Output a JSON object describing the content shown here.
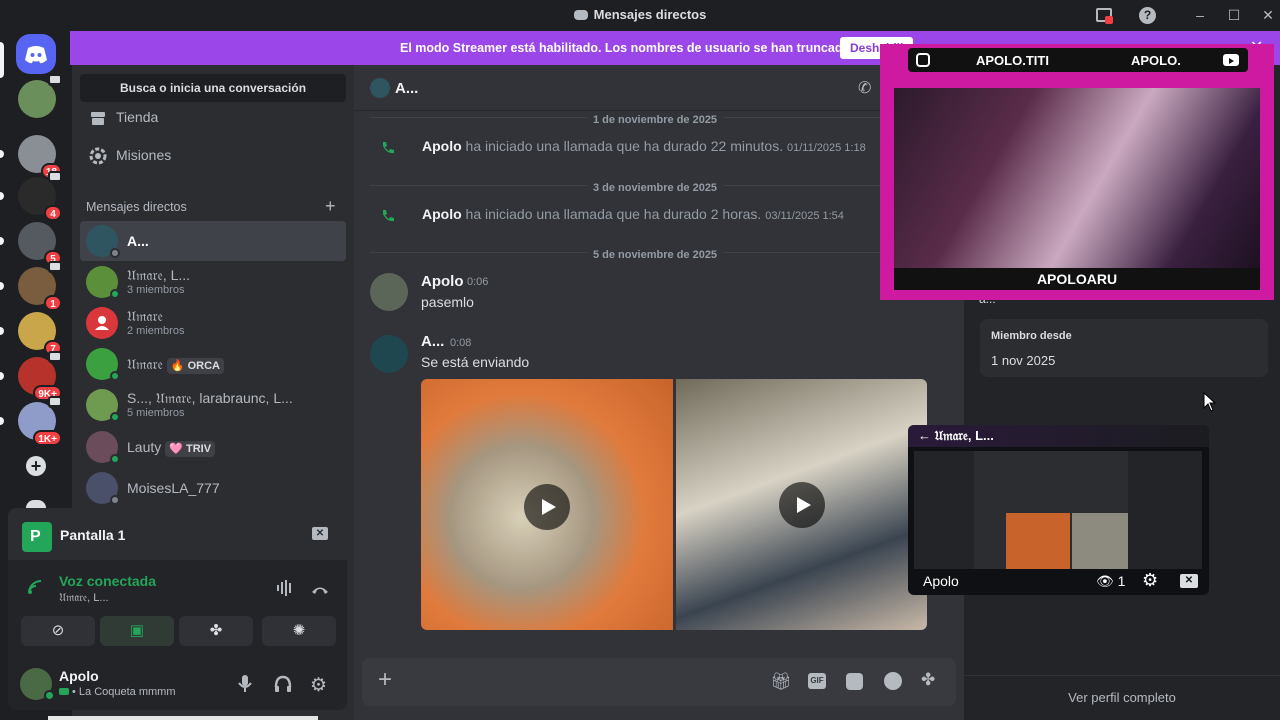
{
  "window": {
    "title": "Mensajes directos"
  },
  "banner": {
    "message": "El modo Streamer está habilitado. Los nombres de usuario se han truncado.",
    "button_label": "Deshabili"
  },
  "servers": {
    "badges": [
      "18",
      "4",
      "5",
      "1",
      "7",
      "9K+",
      "1K+"
    ]
  },
  "sidebar": {
    "search_label": "Busca o inicia una conversación",
    "nav": [
      {
        "label": "Tienda",
        "icon": "shop-icon"
      },
      {
        "label": "Misiones",
        "icon": "quests-icon"
      }
    ],
    "dm_header": "Mensajes directos",
    "dms": [
      {
        "name": "A...",
        "sub": "",
        "tag": ""
      },
      {
        "name": "𝔘𝔪𝔞𝔯𝔢, L...",
        "sub": "3 miembros",
        "tag": ""
      },
      {
        "name": "𝔘𝔪𝔞𝔯𝔢",
        "sub": "2 miembros",
        "tag": ""
      },
      {
        "name": "𝔘𝔪𝔞𝔯𝔢",
        "sub": "",
        "tag": "🔥 ORCA"
      },
      {
        "name": "S..., 𝔘𝔪𝔞𝔯𝔢, larabraunc, L...",
        "sub": "5 miembros",
        "tag": ""
      },
      {
        "name": "Lauty",
        "sub": "",
        "tag": "🩷 TRIV"
      },
      {
        "name": "MoisesLA_777",
        "sub": "",
        "tag": ""
      }
    ]
  },
  "voice": {
    "screen_label": "Pantalla 1",
    "status": "Voz conectada",
    "channel": "𝔘𝔪𝔞𝔯𝔢, L..."
  },
  "user": {
    "name": "Apolo",
    "status": "• La Coqueta mmmm"
  },
  "chat": {
    "header_name": "A...",
    "dividers": [
      "1 de noviembre de 2025",
      "3 de noviembre de 2025",
      "5 de noviembre de 2025"
    ],
    "calls": [
      {
        "who": "Apolo",
        "text": "ha iniciado una llamada que ha durado 22 minutos.",
        "time": "01/11/2025 1:18"
      },
      {
        "who": "Apolo",
        "text": "ha iniciado una llamada que ha durado 2 horas.",
        "time": "03/11/2025 1:54"
      }
    ],
    "messages": [
      {
        "author": "Apolo",
        "time": "0:06",
        "text": "pasemlo"
      },
      {
        "author": "A...",
        "time": "0:08",
        "text": "Se está enviando"
      }
    ]
  },
  "profile": {
    "truncated_name": "a...",
    "member_since_label": "Miembro desde",
    "member_since": "1 nov 2025",
    "view_full": "Ver perfil completo"
  },
  "overlay": {
    "social_left": "APOLO.TITI",
    "social_right": "APOLO.",
    "cam_name": "APOLOARU",
    "pip_title": "← 𝔘𝔪𝔞𝔯𝔢, L...",
    "pip_user": "Apolo",
    "pip_viewers": "1"
  },
  "colors": {
    "accent": "#5865f2",
    "banner": "#9b46e8",
    "online": "#23a55a",
    "overlay": "#cd1aa0"
  }
}
